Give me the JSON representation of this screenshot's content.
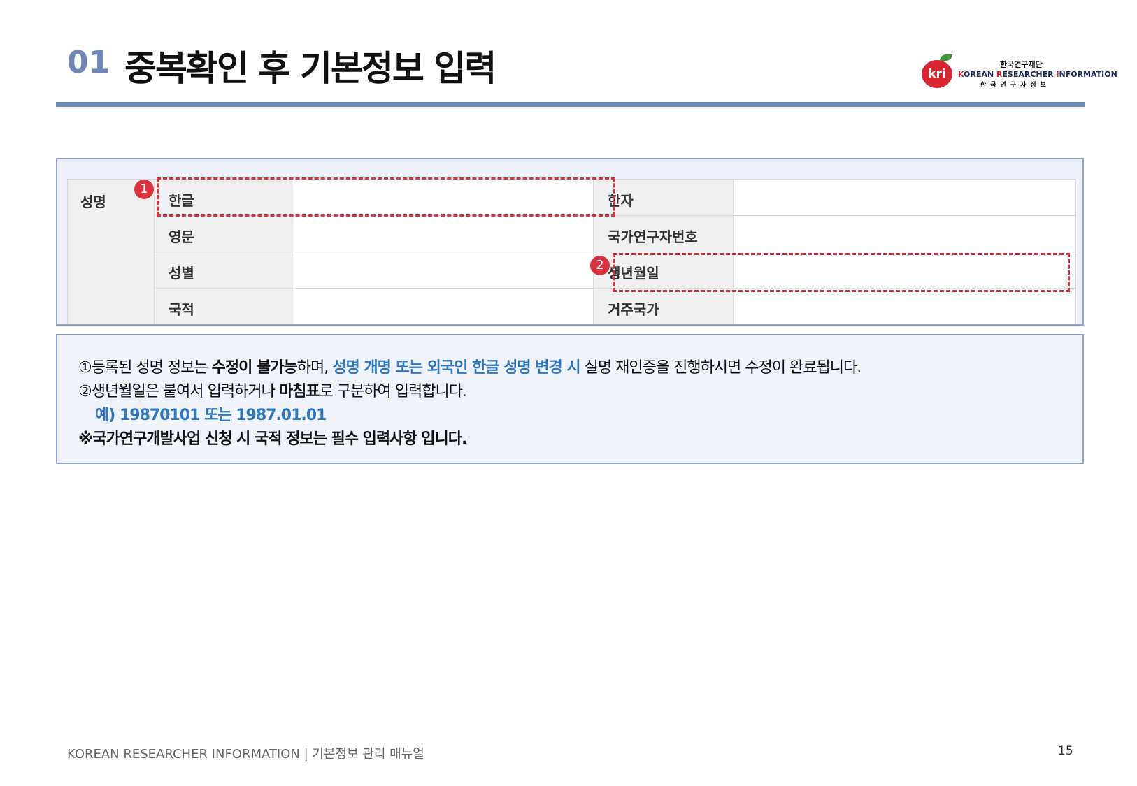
{
  "header": {
    "section_number": "01",
    "title": "중복확인 후 기본정보 입력"
  },
  "logo": {
    "mark": "kri",
    "korean_name": "한국연구재단",
    "english_name_parts": [
      "K",
      "OREAN ",
      "R",
      "ESEARCHER ",
      "I",
      "NFORMATION"
    ],
    "subtitle": "한국연구자정보",
    "brand_color": "#d7262f"
  },
  "form": {
    "group_label": "성명",
    "rows": [
      {
        "left_label": "한글",
        "left_value": "",
        "right_label": "한자",
        "right_value": ""
      },
      {
        "left_label": "영문",
        "left_value": "",
        "right_label": "국가연구자번호",
        "right_value": ""
      },
      {
        "left_label": "성별",
        "left_value": "",
        "right_label": "생년월일",
        "right_value": ""
      },
      {
        "left_label": "국적",
        "left_value": "",
        "right_label": "거주국가",
        "right_value": ""
      }
    ],
    "markers": [
      "1",
      "2"
    ],
    "highlight_color": "#d7343f"
  },
  "notes": {
    "line1": {
      "prefix": "①등록된 성명 정보는 ",
      "bold": "수정이 불가능",
      "mid": "하며, ",
      "blue": "성명 개명 또는 외국인 한글 성명 변경 시",
      "suffix": " 실명 재인증을 진행하시면 수정이 완료됩니다."
    },
    "line2": {
      "prefix": "②생년월일은 붙여서 입력하거나 ",
      "bold": "마침표",
      "suffix": "로 구분하여 입력합니다."
    },
    "line3": "예) 19870101 또는 1987.01.01",
    "line4": "※국가연구개발사업 신청 시 국적 정보는 필수 입력사항 입니다."
  },
  "footer": {
    "text": "KOREAN RESEARCHER INFORMATION  |  기본정보 관리 매뉴얼",
    "page_number": "15"
  }
}
